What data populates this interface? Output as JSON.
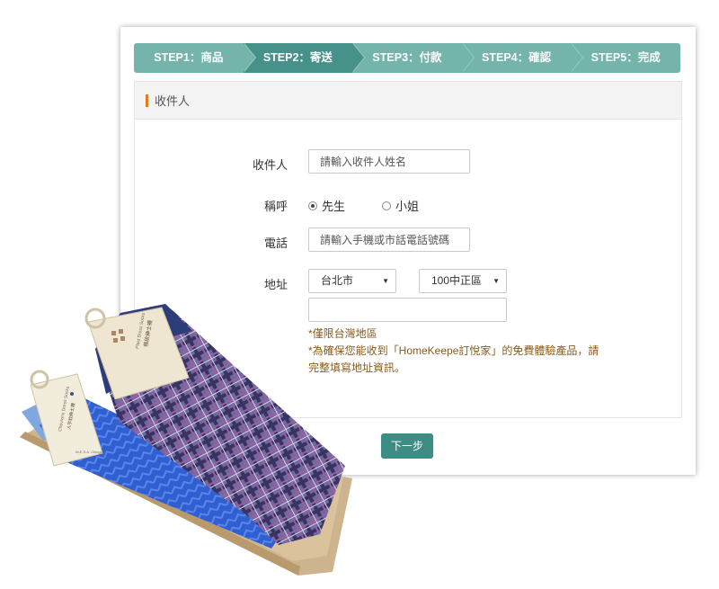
{
  "steps": [
    {
      "label": "STEP1：商品",
      "active": false
    },
    {
      "label": "STEP2：寄送",
      "active": true
    },
    {
      "label": "STEP3：付款",
      "active": false
    },
    {
      "label": "STEP4：確認",
      "active": false
    },
    {
      "label": "STEP5：完成",
      "active": false
    }
  ],
  "section": {
    "title": "收件人"
  },
  "form": {
    "recipient_label": "收件人",
    "recipient_placeholder": "請輸入收件人姓名",
    "title_label": "稱呼",
    "title_options": [
      {
        "label": "先生",
        "checked": true
      },
      {
        "label": "小姐",
        "checked": false
      }
    ],
    "phone_label": "電話",
    "phone_placeholder": "請輸入手機或市話電話號碼",
    "address_label": "地址",
    "city_value": "台北市",
    "district_value": "100中正區",
    "address_value": "",
    "notes": [
      "*僅限台灣地區",
      "*為確保您能收到「HomeKeepe訂悅家」的免費體驗產品，請",
      "完整填寫地址資訊。"
    ]
  },
  "next_button": "下一步",
  "product": {
    "tag_back": [
      "Plaid Dress Socks",
      "格紋紳士襪"
    ],
    "tag_front": [
      "Chevrons Dress Socks",
      "人字紋紳士襪"
    ],
    "brand": "W.E.S.A. Chings"
  },
  "colors": {
    "accent": "#46928a",
    "step_bar": "#74b4ab",
    "button": "#3e8d84",
    "note": "#8a5a1c",
    "head_bar": "#e07b1d"
  }
}
